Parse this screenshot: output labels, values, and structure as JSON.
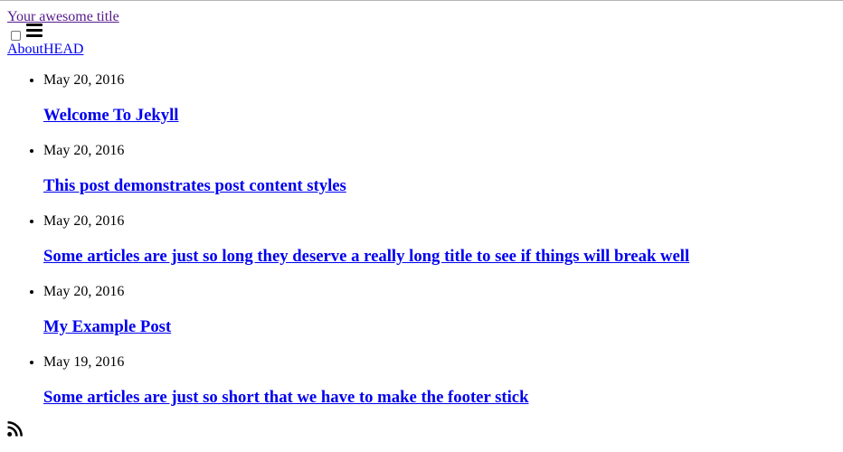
{
  "header": {
    "site_title": "Your awesome title",
    "nav_about": "About",
    "nav_head": "HEAD"
  },
  "posts": [
    {
      "date": "May 20, 2016",
      "title": "Welcome To Jekyll"
    },
    {
      "date": "May 20, 2016",
      "title": "This post demonstrates post content styles"
    },
    {
      "date": "May 20, 2016",
      "title": "Some articles are just so long they deserve a really long title to see if things will break well"
    },
    {
      "date": "May 20, 2016",
      "title": "My Example Post"
    },
    {
      "date": "May 19, 2016",
      "title": "Some articles are just so short that we have to make the footer stick"
    }
  ],
  "icons": {
    "menu": "hamburger-icon",
    "feed": "rss-icon"
  },
  "colors": {
    "visited_link": "#551a8b",
    "link": "#0000ee"
  }
}
